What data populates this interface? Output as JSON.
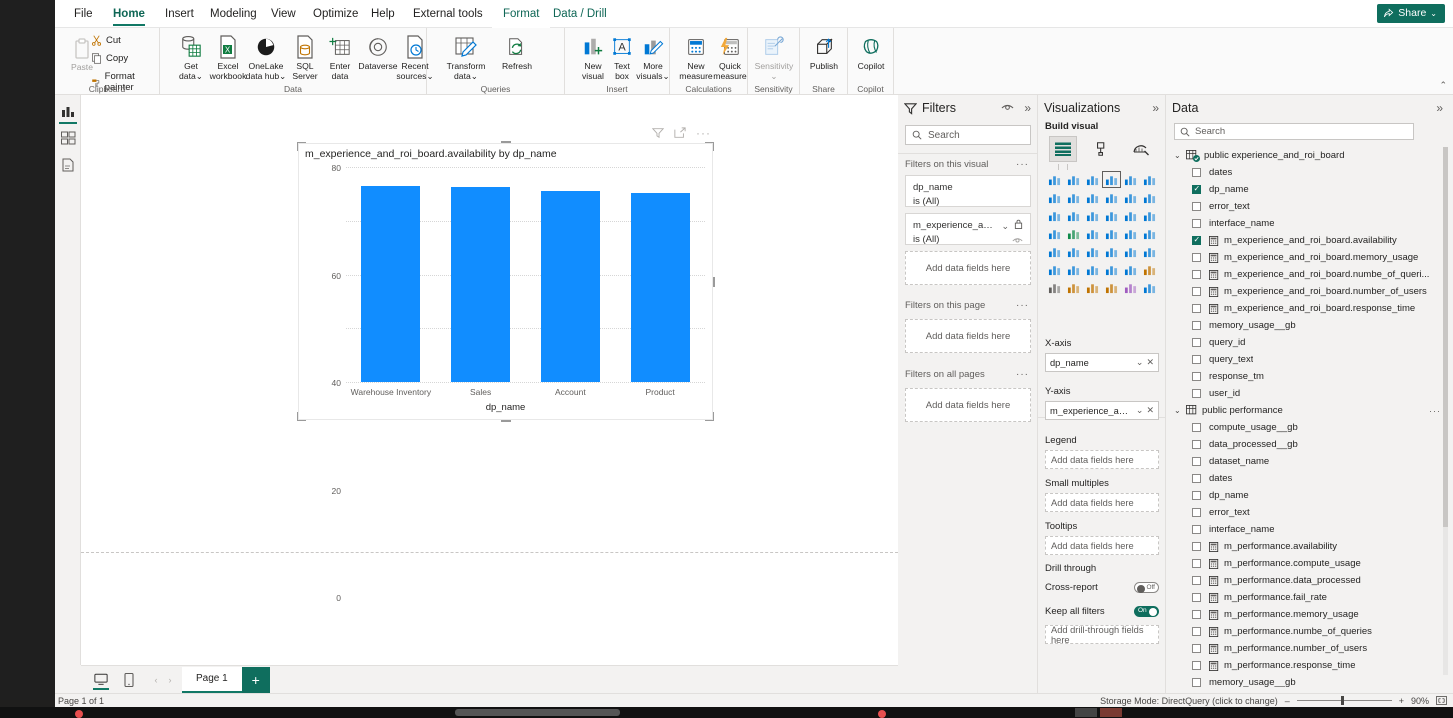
{
  "ribbon": {
    "tabs": [
      {
        "label": "File",
        "state": "normal"
      },
      {
        "label": "Home",
        "state": "active"
      },
      {
        "label": "Insert",
        "state": "normal"
      },
      {
        "label": "Modeling",
        "state": "normal"
      },
      {
        "label": "View",
        "state": "normal"
      },
      {
        "label": "Optimize",
        "state": "normal"
      },
      {
        "label": "Help",
        "state": "normal"
      },
      {
        "label": "External tools",
        "state": "normal"
      },
      {
        "label": "Format",
        "state": "contextual"
      },
      {
        "label": "Data / Drill",
        "state": "contextual"
      }
    ],
    "share_label": "Share",
    "groups": [
      {
        "name": "Clipboard",
        "label": "Clipboard"
      },
      {
        "name": "Data",
        "label": "Data"
      },
      {
        "name": "Queries",
        "label": "Queries"
      },
      {
        "name": "Insert",
        "label": "Insert"
      },
      {
        "name": "Calculations",
        "label": "Calculations"
      },
      {
        "name": "Sensitivity",
        "label": "Sensitivity"
      },
      {
        "name": "Share",
        "label": "Share"
      },
      {
        "name": "Copilot",
        "label": "Copilot"
      }
    ],
    "clipboard": {
      "paste": "Paste",
      "cut": "Cut",
      "copy": "Copy",
      "format_painter": "Format painter"
    },
    "items": {
      "get_data": {
        "line1": "Get",
        "line2": "data"
      },
      "excel_workbook": {
        "line1": "Excel",
        "line2": "workbook"
      },
      "onelake": {
        "line1": "OneLake",
        "line2": "data hub"
      },
      "sql_server": {
        "line1": "SQL",
        "line2": "Server"
      },
      "enter_data": {
        "line1": "Enter",
        "line2": "data"
      },
      "dataverse": {
        "line1": "Dataverse",
        "line2": ""
      },
      "recent_sources": {
        "line1": "Recent",
        "line2": "sources"
      },
      "transform_data": {
        "line1": "Transform",
        "line2": "data"
      },
      "refresh": {
        "line1": "Refresh",
        "line2": ""
      },
      "new_visual": {
        "line1": "New",
        "line2": "visual"
      },
      "text_box": {
        "line1": "Text",
        "line2": "box"
      },
      "more_visuals": {
        "line1": "More",
        "line2": "visuals"
      },
      "new_measure": {
        "line1": "New",
        "line2": "measure"
      },
      "quick_measure": {
        "line1": "Quick",
        "line2": "measure"
      },
      "sensitivity": {
        "line1": "Sensitivity",
        "line2": ""
      },
      "publish": {
        "line1": "Publish",
        "line2": ""
      },
      "copilot": {
        "line1": "Copilot",
        "line2": ""
      }
    }
  },
  "view_rail": {
    "items": [
      {
        "name": "report-view",
        "selected": true
      },
      {
        "name": "table-view",
        "selected": false
      },
      {
        "name": "model-view",
        "selected": false
      }
    ]
  },
  "chart_data": {
    "type": "bar",
    "title": "m_experience_and_roi_board.availability by dp_name",
    "categories": [
      "Warehouse Inventory",
      "Sales",
      "Account",
      "Product"
    ],
    "values": [
      73.0,
      72.4,
      71.0,
      70.5
    ],
    "xlabel": "dp_name",
    "ylabel": "m_experience_and_roi_board.availability",
    "ylim": [
      0,
      80
    ],
    "yticks": [
      0,
      20,
      40,
      60,
      80
    ],
    "grid": true,
    "legend": "none",
    "bar_color": "#118DFF"
  },
  "visual_header": {
    "filter_icon": "filter-icon",
    "focus_icon": "focus-mode-icon",
    "more_icon": "more-options-icon"
  },
  "filters_pane": {
    "title": "Filters",
    "search_placeholder": "Search",
    "sections": [
      {
        "label": "Filters on this visual",
        "cards": [
          {
            "field": "dp_name",
            "condition": "is (All)",
            "has_icons": false
          },
          {
            "field": "m_experience_and_roi_...",
            "condition": "is (All)",
            "has_icons": true
          }
        ],
        "drop_label": "Add data fields here"
      },
      {
        "label": "Filters on this page",
        "cards": [],
        "drop_label": "Add data fields here"
      },
      {
        "label": "Filters on all pages",
        "cards": [],
        "drop_label": "Add data fields here"
      }
    ]
  },
  "visualizations_pane": {
    "title": "Visualizations",
    "build_visual_label": "Build visual",
    "tabs": [
      {
        "name": "build-visual-tab",
        "selected": true
      },
      {
        "name": "format-visual-tab",
        "selected": false
      },
      {
        "name": "analytics-tab",
        "selected": false
      }
    ],
    "gallery_more": "...",
    "selected_visual_index": 3,
    "wells": [
      {
        "label": "X-axis",
        "type": "field",
        "value": "dp_name"
      },
      {
        "label": "Y-axis",
        "type": "field",
        "value": "m_experience_and_roi..."
      },
      {
        "label": "Legend",
        "type": "drop",
        "value": "Add data fields here"
      },
      {
        "label": "Small multiples",
        "type": "drop",
        "value": "Add data fields here"
      },
      {
        "label": "Tooltips",
        "type": "drop",
        "value": "Add data fields here"
      }
    ],
    "drill_through_label": "Drill through",
    "toggles": [
      {
        "label": "Cross-report",
        "state": "Off",
        "on": false
      },
      {
        "label": "Keep all filters",
        "state": "On",
        "on": true
      }
    ],
    "drill_drop_label": "Add drill-through fields here"
  },
  "data_pane": {
    "title": "Data",
    "search_placeholder": "Search",
    "tables": [
      {
        "name": "public experience_and_roi_board",
        "expanded": true,
        "icon": "table-directquery-icon",
        "fields": [
          {
            "label": "dates",
            "checked": false,
            "measure": false
          },
          {
            "label": "dp_name",
            "checked": true,
            "measure": false
          },
          {
            "label": "error_text",
            "checked": false,
            "measure": false
          },
          {
            "label": "interface_name",
            "checked": false,
            "measure": false
          },
          {
            "label": "m_experience_and_roi_board.availability",
            "checked": true,
            "measure": true
          },
          {
            "label": "m_experience_and_roi_board.memory_usage",
            "checked": false,
            "measure": true
          },
          {
            "label": "m_experience_and_roi_board.numbe_of_queri...",
            "checked": false,
            "measure": true
          },
          {
            "label": "m_experience_and_roi_board.number_of_users",
            "checked": false,
            "measure": true
          },
          {
            "label": "m_experience_and_roi_board.response_time",
            "checked": false,
            "measure": true
          },
          {
            "label": "memory_usage__gb",
            "checked": false,
            "measure": false
          },
          {
            "label": "query_id",
            "checked": false,
            "measure": false
          },
          {
            "label": "query_text",
            "checked": false,
            "measure": false
          },
          {
            "label": "response_tm",
            "checked": false,
            "measure": false
          },
          {
            "label": "user_id",
            "checked": false,
            "measure": false
          }
        ]
      },
      {
        "name": "public performance",
        "expanded": true,
        "icon": "table-icon",
        "fields": [
          {
            "label": "compute_usage__gb",
            "checked": false,
            "measure": false
          },
          {
            "label": "data_processed__gb",
            "checked": false,
            "measure": false
          },
          {
            "label": "dataset_name",
            "checked": false,
            "measure": false
          },
          {
            "label": "dates",
            "checked": false,
            "measure": false
          },
          {
            "label": "dp_name",
            "checked": false,
            "measure": false
          },
          {
            "label": "error_text",
            "checked": false,
            "measure": false
          },
          {
            "label": "interface_name",
            "checked": false,
            "measure": false
          },
          {
            "label": "m_performance.availability",
            "checked": false,
            "measure": true
          },
          {
            "label": "m_performance.compute_usage",
            "checked": false,
            "measure": true
          },
          {
            "label": "m_performance.data_processed",
            "checked": false,
            "measure": true
          },
          {
            "label": "m_performance.fail_rate",
            "checked": false,
            "measure": true
          },
          {
            "label": "m_performance.memory_usage",
            "checked": false,
            "measure": true
          },
          {
            "label": "m_performance.numbe_of_queries",
            "checked": false,
            "measure": true
          },
          {
            "label": "m_performance.number_of_users",
            "checked": false,
            "measure": true
          },
          {
            "label": "m_performance.response_time",
            "checked": false,
            "measure": true
          },
          {
            "label": "memory_usage__gb",
            "checked": false,
            "measure": false
          }
        ]
      }
    ]
  },
  "page_bar": {
    "views": [
      {
        "name": "desktop-layout-icon",
        "selected": true
      },
      {
        "name": "mobile-layout-icon",
        "selected": false
      }
    ],
    "prev_arrow": "‹",
    "next_arrow": "›",
    "tabs": [
      {
        "label": "Page 1",
        "selected": true
      }
    ],
    "add_label": "+"
  },
  "status_bar": {
    "page_indicator": "Page 1 of 1",
    "storage_mode": "Storage Mode: DirectQuery (click to change)",
    "zoom_minus": "–",
    "zoom_plus": "+",
    "zoom_level": "90%",
    "fit_icon": "fit-to-page-icon"
  },
  "colors": {
    "brand_teal": "#0f6e5e",
    "accent_blue": "#118DFF",
    "pane_bg": "#f3f2f1"
  }
}
